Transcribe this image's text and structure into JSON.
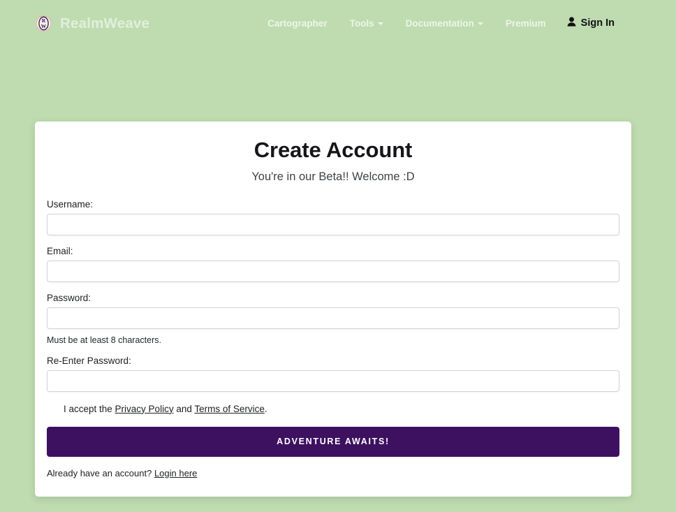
{
  "theme": {
    "page_background": "#bedcb0",
    "card_background": "#ffffff",
    "button_purple": "#3d1060",
    "nav_link_color": "#ffffff",
    "signin_color": "#101014"
  },
  "navbar": {
    "brand_name": "RealmWeave",
    "brand_logo_icon": "realmweave-circle-monogram-icon",
    "brand_logo_letters": "RW",
    "links": [
      {
        "label": "Cartographer",
        "has_caret": false
      },
      {
        "label": "Tools",
        "has_caret": true
      },
      {
        "label": "Documentation",
        "has_caret": true
      },
      {
        "label": "Premium",
        "has_caret": false
      }
    ],
    "signin": {
      "label": "Sign In",
      "icon": "person-icon"
    }
  },
  "card": {
    "title": "Create Account",
    "subtitle": "You're in our Beta!! Welcome :D",
    "fields": {
      "username": {
        "label": "Username:",
        "value": "",
        "placeholder": ""
      },
      "email": {
        "label": "Email:",
        "value": "",
        "placeholder": ""
      },
      "password": {
        "label": "Password:",
        "value": "",
        "placeholder": "",
        "help": "Must be at least 8 characters."
      },
      "confirm_password": {
        "label": "Re-Enter Password:",
        "value": "",
        "placeholder": ""
      }
    },
    "terms": {
      "prefix": "I accept the ",
      "privacy_label": "Privacy Policy",
      "conjunction": " and ",
      "terms_label": "Terms of Service",
      "suffix": ".",
      "checked": false
    },
    "submit_label": "ADVENTURE AWAITS!",
    "footer": {
      "text": "Already have an account? ",
      "link_label": "Login here"
    }
  }
}
